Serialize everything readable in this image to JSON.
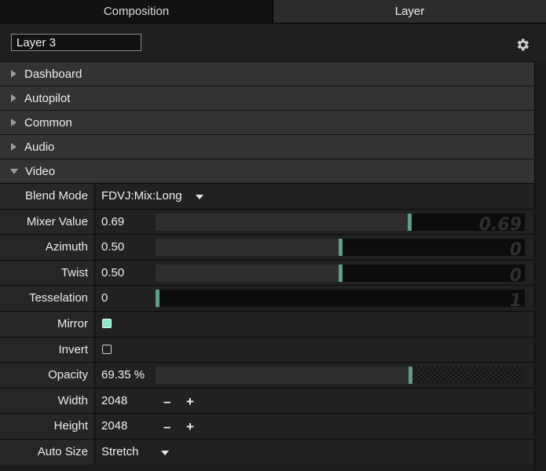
{
  "tabs": [
    "Composition",
    "Layer"
  ],
  "layer_name": "Layer 3",
  "sections": [
    "Dashboard",
    "Autopilot",
    "Common",
    "Audio",
    "Video"
  ],
  "video": {
    "blend_mode": {
      "label": "Blend Mode",
      "value": "FDVJ:Mix:Long"
    },
    "mixer_value": {
      "label": "Mixer Value",
      "value": "0.69",
      "ghost": "0.69",
      "level": 0.69
    },
    "azimuth": {
      "label": "Azimuth",
      "value": "0.50",
      "ghost": "0",
      "level": 0.5
    },
    "twist": {
      "label": "Twist",
      "value": "0.50",
      "ghost": "0",
      "level": 0.5
    },
    "tesselation": {
      "label": "Tesselation",
      "value": "0",
      "ghost": "1",
      "level": 0.0
    },
    "mirror": {
      "label": "Mirror",
      "checked": true
    },
    "invert": {
      "label": "Invert",
      "checked": false
    },
    "opacity": {
      "label": "Opacity",
      "value": "69.35 %",
      "level": 0.6935
    },
    "width": {
      "label": "Width",
      "value": "2048",
      "minus": "–",
      "plus": "+"
    },
    "height": {
      "label": "Height",
      "value": "2048",
      "minus": "–",
      "plus": "+"
    },
    "auto_size": {
      "label": "Auto Size",
      "value": "Stretch"
    }
  },
  "colors": {
    "accent": "#5e9e8a",
    "checkbox_on": "#8fe8c7"
  },
  "icons": {
    "settings": "gear-icon",
    "collapsed": "triangle-right-icon",
    "expanded": "triangle-down-icon"
  }
}
